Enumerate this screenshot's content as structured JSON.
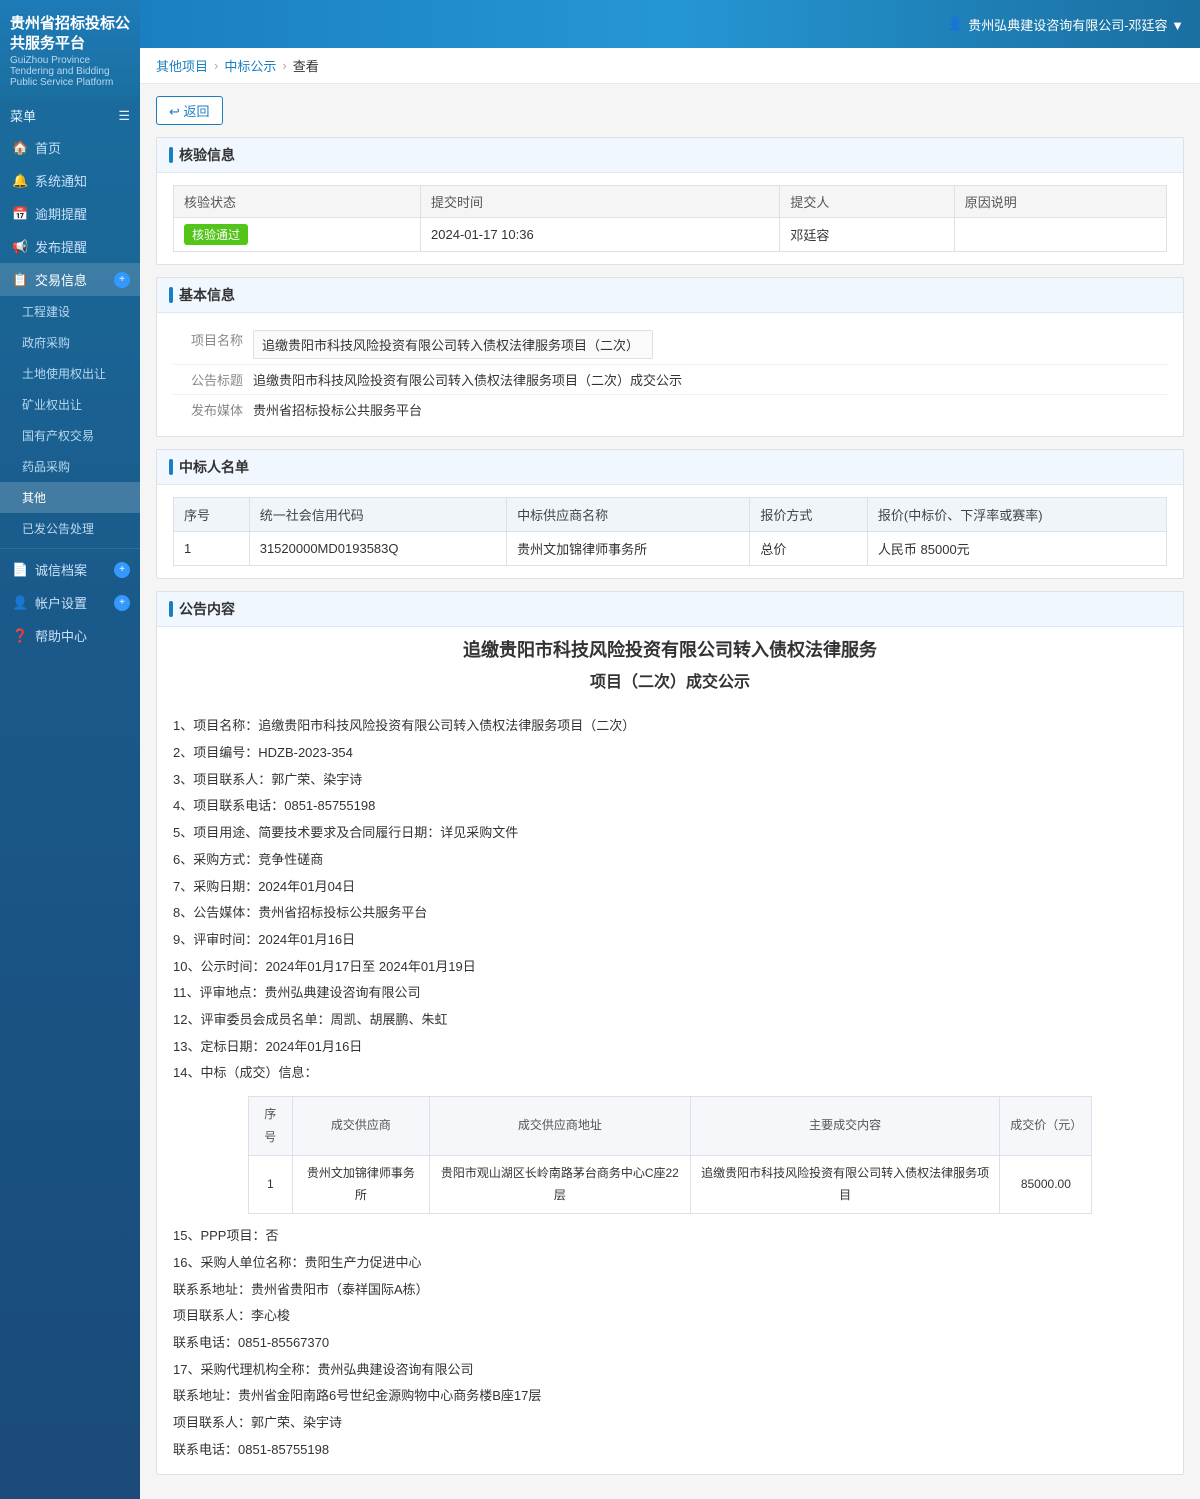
{
  "header": {
    "logo_title": "贵州省招标投标公共服务平台",
    "logo_subtitle": "GuiZhou Province Tendering and Bidding Public Service Platform",
    "user_label": "贵州弘典建设咨询有限公司-邓廷容 ▼"
  },
  "breadcrumb": {
    "items": [
      "其他项目",
      "中标公示",
      "查看"
    ]
  },
  "back_button": "↩ 返回",
  "sidebar": {
    "menu_label": "菜单",
    "items": [
      {
        "label": "首页",
        "icon": "🏠",
        "type": "main"
      },
      {
        "label": "系统通知",
        "icon": "🔔",
        "type": "main"
      },
      {
        "label": "逾期提醒",
        "icon": "📅",
        "type": "main"
      },
      {
        "label": "发布提醒",
        "icon": "📢",
        "type": "main"
      },
      {
        "label": "交易信息",
        "icon": "📋",
        "type": "main",
        "active": true,
        "badge": true
      },
      {
        "label": "工程建设",
        "icon": "",
        "type": "sub"
      },
      {
        "label": "政府采购",
        "icon": "",
        "type": "sub"
      },
      {
        "label": "土地使用权出让",
        "icon": "",
        "type": "sub"
      },
      {
        "label": "矿业权出让",
        "icon": "",
        "type": "sub"
      },
      {
        "label": "国有产权交易",
        "icon": "",
        "type": "sub"
      },
      {
        "label": "药品采购",
        "icon": "",
        "type": "sub"
      },
      {
        "label": "其他",
        "icon": "",
        "type": "sub",
        "active": true
      },
      {
        "label": "已发公告处理",
        "icon": "",
        "type": "sub"
      },
      {
        "label": "诚信档案",
        "icon": "📄",
        "type": "main",
        "badge": true
      },
      {
        "label": "帐户设置",
        "icon": "👤",
        "type": "main",
        "badge": true
      },
      {
        "label": "帮助中心",
        "icon": "❓",
        "type": "main"
      }
    ]
  },
  "validation": {
    "section_title": "核验信息",
    "columns": [
      "核验状态",
      "提交时间",
      "提交人",
      "原因说明"
    ],
    "rows": [
      {
        "status": "核验通过",
        "time": "2024-01-17 10:36",
        "submitter": "邓廷容",
        "reason": ""
      }
    ]
  },
  "basic_info": {
    "section_title": "基本信息",
    "fields": [
      {
        "label": "项目名称",
        "value": "追缴贵阳市科技风险投资有限公司转入债权法律服务项目（二次）",
        "boxed": true
      },
      {
        "label": "公告标题",
        "value": "追缴贵阳市科技风险投资有限公司转入债权法律服务项目（二次）成交公示"
      },
      {
        "label": "发布媒体",
        "value": "贵州省招标投标公共服务平台"
      }
    ]
  },
  "winner_list": {
    "section_title": "中标人名单",
    "columns": [
      "序号",
      "统一社会信用代码",
      "中标供应商名称",
      "报价方式",
      "报价(中标价、下浮率或赛率)"
    ],
    "rows": [
      {
        "seq": "1",
        "credit_code": "31520000MD0193583Q",
        "name": "贵州文加锦律师事务所",
        "quote_type": "总价",
        "quote_value": "人民币 85000元"
      }
    ]
  },
  "announcement": {
    "section_title": "公告内容",
    "title_line1": "追缴贵阳市科技风险投资有限公司转入债权法律服务",
    "title_line2": "项目（二次）成交公示",
    "items": [
      "1、项目名称：追缴贵阳市科技风险投资有限公司转入债权法律服务项目（二次）",
      "2、项目编号：HDZB-2023-354",
      "3、项目联系人：郭广荣、染宇诗",
      "4、项目联系电话：0851-85755198",
      "5、项目用途、简要技术要求及合同履行日期：详见采购文件",
      "6、采购方式：竞争性磋商",
      "7、采购日期：2024年01月04日",
      "8、公告媒体：贵州省招标投标公共服务平台",
      "9、评审时间：2024年01月16日",
      "10、公示时间：2024年01月17日至 2024年01月19日",
      "11、评审地点：贵州弘典建设咨询有限公司",
      "12、评审委员会成员名单：周凯、胡展鹏、朱虹",
      "13、定标日期：2024年01月16日",
      "14、中标（成交）信息："
    ],
    "trans_table": {
      "columns": [
        "序号",
        "成交供应商",
        "成交供应商地址",
        "主要成交内容",
        "成交价（元）"
      ],
      "rows": [
        {
          "seq": "1",
          "supplier": "贵州文加锦律师事务所",
          "address": "贵阳市观山湖区长岭南路茅台商务中心C座22层",
          "content": "追缴贵阳市科技风险投资有限公司转入债权法律服务项目",
          "price": "85000.00"
        }
      ]
    },
    "items_after": [
      "15、PPP项目：否",
      "16、采购人单位名称：贵阳生产力促进中心",
      "联系系地址：贵州省贵阳市（泰祥国际A栋）",
      "项目联系人：李心梭",
      "联系电话：0851-85567370",
      "17、采购代理机构全称：贵州弘典建设咨询有限公司",
      "联系地址：贵州省金阳南路6号世纪金源购物中心商务楼B座17层",
      "项目联系人：郭广荣、染宇诗",
      "联系电话：0851-85755198"
    ]
  }
}
